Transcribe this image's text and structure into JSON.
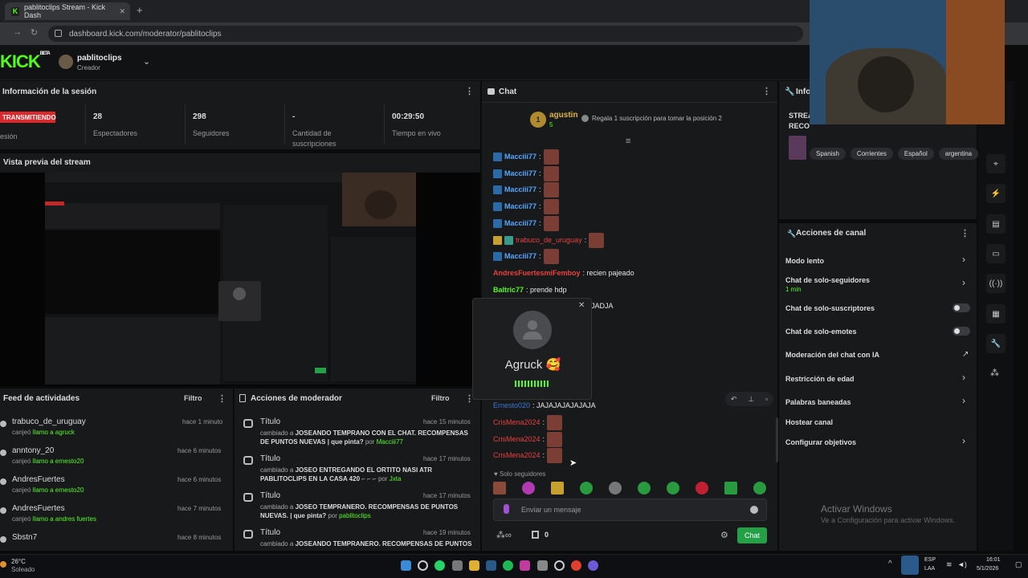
{
  "browser": {
    "tab_title": "pablitoclips Stream - Kick Dash",
    "tab_icon": "K",
    "close": "✕",
    "new_tab": "+",
    "url": "dashboard.kick.com/moderator/pablitoclips"
  },
  "header": {
    "logo": "KICK",
    "logo_sup": "BETA",
    "channel_name": "pablitoclips",
    "channel_role": "Creador"
  },
  "session": {
    "title": "Información de la sesión",
    "live_badge": "TRANSMITIENDO",
    "session_label": "esión",
    "stats": [
      {
        "value": "28",
        "label": "Espectadores"
      },
      {
        "value": "298",
        "label": "Seguidores"
      },
      {
        "value": "-",
        "label": "Cantidad de suscripciones"
      },
      {
        "value": "00:29:50",
        "label": "Tiempo en vivo"
      }
    ]
  },
  "preview": {
    "title": "Vista previa del stream"
  },
  "feed": {
    "title": "Feed de actividades",
    "filter": "Filtro",
    "items": [
      {
        "name": "trabuco_de_uruguay",
        "sub1": "canjeó ",
        "sub2": "llamo a agruck",
        "time": "hace 1 minuto"
      },
      {
        "name": "anntony_20",
        "sub1": "canjeó ",
        "sub2": "llamo a ernesto20",
        "time": "hace 6 minutos"
      },
      {
        "name": "AndresFuertes",
        "sub1": "canjeó ",
        "sub2": "llamo a ernesto20",
        "time": "hace 6 minutos"
      },
      {
        "name": "AndresFuertes",
        "sub1": "canjeó ",
        "sub2": "llamo a andres fuertes",
        "time": "hace 7 minutos"
      },
      {
        "name": "Sbstn7",
        "sub1": "",
        "sub2": "",
        "time": "hace 8 minutos"
      }
    ]
  },
  "modactions": {
    "title": "Acciones de moderador",
    "filter": "Filtro",
    "items": [
      {
        "title": "Título",
        "time": "hace 15 minutos",
        "pre": "cambiado a ",
        "bold": "JOSEANDO TEMPRANO CON EL CHAT. RECOMPENSAS DE PUNTOS NUEVAS | que pinta?",
        "por": " por ",
        "user": "Macciii77"
      },
      {
        "title": "Título",
        "time": "hace 17 minutos",
        "pre": "cambiado a ",
        "bold": "JOSEO ENTREGANDO EL ORTITO NASI ATR PABLITOCLIPS EN LA CASA 420",
        "por": " ⌐ ⌐ ⌐ por ",
        "user": "Jxta"
      },
      {
        "title": "Título",
        "time": "hace 17 minutos",
        "pre": "cambiado a ",
        "bold": "JOSEO TEMPRANERO. RECOMPENSAS DE PUNTOS NUEVAS. | que pinta?",
        "por": " por ",
        "user": "pablitoclips"
      },
      {
        "title": "Título",
        "time": "hace 19 minutos",
        "pre": "cambiado a ",
        "bold": "JOSEANDO TEMPRANERO. RECOMPENSAS DE PUNTOS",
        "por": "",
        "user": ""
      }
    ]
  },
  "chat": {
    "title": "Chat",
    "gifter_rank": "1",
    "gifter_name": "agustin",
    "gifter_count": "5",
    "gift_prompt": "Regala 1 suscripción para tomar la posición 2",
    "messages": [
      {
        "user": "Macciii77",
        "text": ":",
        "color": "blue"
      },
      {
        "user": "Macciii77",
        "text": ":",
        "color": "blue"
      },
      {
        "user": "Macciii77",
        "text": ":",
        "color": "blue"
      },
      {
        "user": "Macciii77",
        "text": ":",
        "color": "blue"
      },
      {
        "user": "Macciii77",
        "text": ":",
        "color": "blue"
      },
      {
        "user": "trabuco_de_uruguay",
        "text": ":",
        "color": "red"
      },
      {
        "user": "Macciii77",
        "text": ":",
        "color": "blue"
      },
      {
        "user": "AndresFuertesmiFemboy",
        "text": ": recien pajeado",
        "color": "red"
      },
      {
        "user": "Baltric77",
        "text": ": prende hdp",
        "color": "green"
      },
      {
        "user": "",
        "text": "JADJA",
        "color": "none"
      },
      {
        "user": "Ernesto020",
        "text": ": JAJAJAJAJAJAJA",
        "color": "blue"
      },
      {
        "user": "CrisMena2024",
        "text": ":",
        "color": "red"
      },
      {
        "user": "CrisMena2024",
        "text": ":",
        "color": "red"
      },
      {
        "user": "CrisMena2024",
        "text": ":",
        "color": "red"
      }
    ],
    "popup_name": "Agruck 🥰",
    "followers_only": "Solo seguidores",
    "input_placeholder": "Enviar un mensaje",
    "send_label": "Chat",
    "points": "0"
  },
  "info": {
    "title": "Info",
    "stream_title_1": "STREA",
    "stream_title_2": "RECO",
    "tags": [
      "Spanish",
      "Corrientes",
      "Español",
      "argentina"
    ]
  },
  "actions": {
    "title": "Acciones de canal",
    "items": [
      {
        "label": "Modo lento",
        "sub": "",
        "kind": "chevron"
      },
      {
        "label": "Chat de solo-seguidores",
        "sub": "1 min",
        "kind": "chevron"
      },
      {
        "label": "Chat de solo-suscriptores",
        "sub": "",
        "kind": "toggle"
      },
      {
        "label": "Chat de solo-emotes",
        "sub": "",
        "kind": "toggle"
      },
      {
        "label": "Moderación del chat con IA",
        "sub": "",
        "kind": "external"
      },
      {
        "label": "Restricción de edad",
        "sub": "",
        "kind": "chevron"
      },
      {
        "label": "Palabras baneadas",
        "sub": "",
        "kind": "chevron"
      },
      {
        "label": "Hostear canal",
        "sub": "",
        "kind": "none"
      },
      {
        "label": "Configurar objetivos",
        "sub": "",
        "kind": "chevron"
      }
    ]
  },
  "windows": {
    "activate_title": "Activar Windows",
    "activate_sub": "Ve a Configuración para activar Windows."
  },
  "taskbar": {
    "temp": "26°C",
    "weather": "Soleado",
    "lang1": "ESP",
    "lang2": "LAA",
    "time": "16:01",
    "date": "5/1/2026"
  },
  "colors": {
    "kick_green": "#53fc18",
    "live_red": "#e0282c",
    "chat_button": "#24a046"
  }
}
